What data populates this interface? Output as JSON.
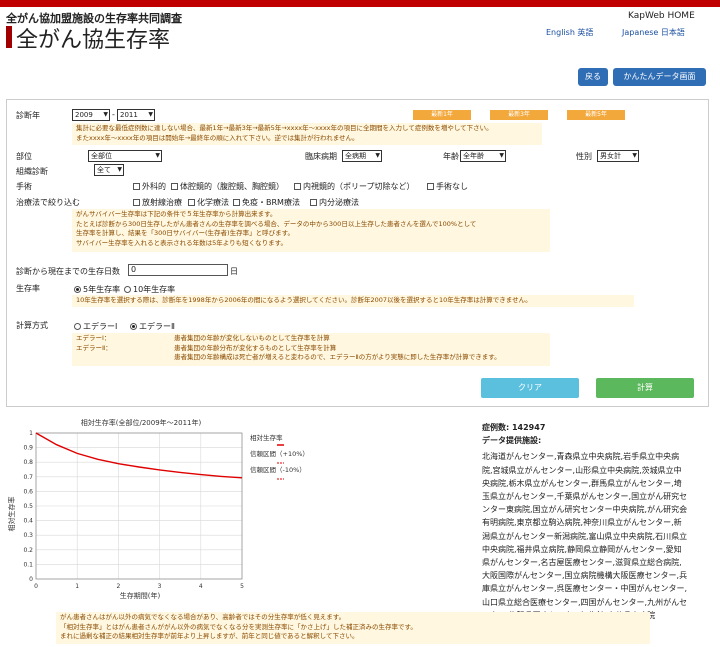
{
  "header": {
    "subtitle": "全がん協加盟施設の生存率共同調査",
    "title": "全がん協生存率",
    "kapweb": "KapWeb HOME",
    "english": "English 英語",
    "japanese": "Japanese 日本語",
    "back": "戻る",
    "easy_screen": "かんたんデータ画面"
  },
  "form": {
    "diag_year_label": "診断年",
    "year_from": "2009",
    "year_sep": "-",
    "year_to": "2011",
    "recent1": "最新1年",
    "recent3": "最新3年",
    "recent5": "最新5年",
    "year_note": [
      "集計に必要な最低症例数に達しない場合、最新1年→最新3年→最新5年→xxxx年～xxxx年の項目に全期間を入力して症例数を増やして下さい。",
      "またxxxx年～xxxx年の項目は開始年→最終年の順に入れて下さい。逆では集計が行われません。"
    ],
    "site_label": "部位",
    "site_value": "全部位",
    "stage_label": "臨床病期",
    "stage_value": "全病期",
    "age_label": "年齢",
    "age_value": "全年齢",
    "sex_label": "性別",
    "sex_value": "男女計",
    "histology_label": "組織診断",
    "histology_value": "全て",
    "surgery_label": "手術",
    "surgery_options": [
      "外科的",
      "体腔鏡的（腹腔鏡、胸腔鏡）",
      "内視鏡的（ポリープ切除など）",
      "手術なし"
    ],
    "therapy_label": "治療法で絞り込む",
    "therapy_options": [
      "放射線治療",
      "化学療法",
      "免疫・BRM療法",
      "内分泌療法"
    ],
    "survivor_note": [
      "がんサバイバー生存率は下記の条件で５年生存率から計算出来ます。",
      "たとえば診断から300日生存したがん患者さんの生存率を調べる場合、データの中から300日以上生存した患者さんを選んで100%として",
      "生存率を計算し、結果を「300日サバイバー(生存者)生存率」と呼びます。",
      "サバイバー生存率を入れると表示される年数は5年よりも短くなります。"
    ],
    "days_label": "診断から現在までの生存日数",
    "days_value": "0",
    "days_unit": "日",
    "rate_label": "生存率",
    "rate5": "5年生存率",
    "rate10": "10年生存率",
    "rate_note": "10年生存率を選択する際は、診断年を1998年から2006年の間になるよう選択してください。診断年2007以後を選択すると10年生存率は計算できません。",
    "method_label": "計算方式",
    "method1": "エデラーⅠ",
    "method2": "エデラーⅡ",
    "method_note": {
      "e1_name": "エデラーⅠ：",
      "e1_text": "患者集団の年齢が変化しないものとして生存率を計算",
      "e2_name": "エデラーⅡ：",
      "e2_text": "患者集団の年齢分布が変化するものとして生存率を計算",
      "e2_extra": "患者集団の年齢構成は死亡者が増えると変わるので、エデラーⅡの方がより実態に即した生存率が計算できます。"
    },
    "clear": "クリア",
    "calc": "計算"
  },
  "chart_data": {
    "type": "line",
    "title": "相対生存率(全部位/2009年～2011年)",
    "xlabel": "生存期間(年)",
    "ylabel": "相対生存率",
    "xlim": [
      0,
      5
    ],
    "ylim": [
      0,
      1
    ],
    "xticks": [
      "0",
      "1",
      "2",
      "3",
      "4",
      "5"
    ],
    "yticks": [
      "0",
      "0.1",
      "0.2",
      "0.3",
      "0.4",
      "0.5",
      "0.6",
      "0.7",
      "0.8",
      "0.9",
      "1"
    ],
    "grid": true,
    "legend": "right",
    "series": [
      {
        "name": "相対生存率",
        "color": "#e00000",
        "x": [
          0,
          0.5,
          1,
          1.5,
          2,
          2.5,
          3,
          3.5,
          4,
          4.5,
          5
        ],
        "y": [
          1.0,
          0.92,
          0.86,
          0.82,
          0.79,
          0.767,
          0.747,
          0.73,
          0.715,
          0.703,
          0.693
        ]
      }
    ],
    "legend_entries": [
      "相対生存率",
      "信頼区間（+10%）",
      "信頼区間（-10%）"
    ]
  },
  "results": {
    "cases": "症例数: 142947",
    "provider_title": "データ提供施設:",
    "providers": [
      "北海道がんセンター,青森県立中央病院,岩手県立中央病",
      "院,宮城県立がんセンター,山形県立中央病院,茨城県立中",
      "央病院,栃木県立がんセンター,群馬県立がんセンター,埼",
      "玉県立がんセンター,千葉県がんセンター,国立がん研究セ",
      "ンター東病院,国立がん研究センター中央病院,がん研究会",
      "有明病院,東京都立駒込病院,神奈川県立がんセンター,新",
      "潟県立がんセンター新潟病院,富山県立中央病院,石川県立",
      "中央病院,福井県立病院,静岡県立静岡がんセンター,愛知",
      "県がんセンター,名古屋医療センター,滋賀県立総合病院,",
      "大阪国際がんセンター,国立病院機構大阪医療センター,兵",
      "庫県立がんセンター,呉医療センター・中国がんセンター,",
      "山口県立総合医療センター,四国がんセンター,九州がんセ",
      "ンター,佐賀県医療センター好生館,大分県立病院"
    ]
  },
  "bottom_note": [
    "がん患者さんはがん以外の病気でなくなる場合があり、高齢者ではその分生存率が低く見えます。",
    "「相対生存率」とはがん患者さんががん以外の病気でなくなる分を実測生存率に「かさ上げ」した補正済みの生存率です。",
    "まれに過剰な補正の結果相対生存率が前年より上昇しますが、前年と同じ値であると解釈して下さい。"
  ]
}
